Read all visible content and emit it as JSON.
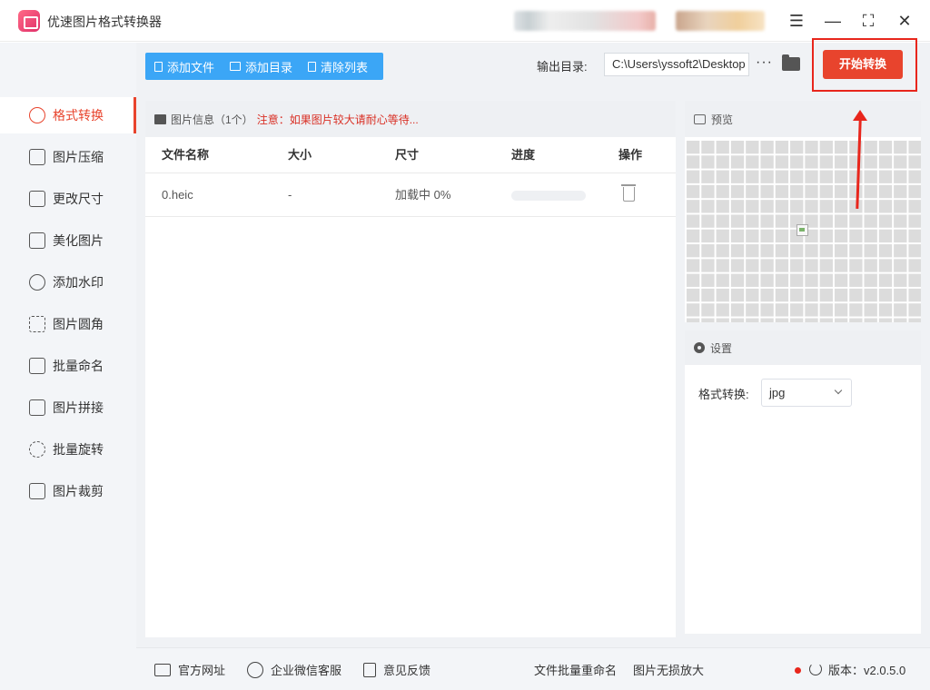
{
  "app": {
    "title": "优速图片格式转换器"
  },
  "window": {
    "menu_icon": "hamburger-menu-icon",
    "minimize": "—",
    "maximize": "⛶",
    "close": "✕"
  },
  "sidebar": {
    "items": [
      {
        "label": "格式转换",
        "icon": "format-convert-icon",
        "active": true
      },
      {
        "label": "图片压缩",
        "icon": "compress-icon"
      },
      {
        "label": "更改尺寸",
        "icon": "resize-icon"
      },
      {
        "label": "美化图片",
        "icon": "beautify-icon"
      },
      {
        "label": "添加水印",
        "icon": "watermark-icon"
      },
      {
        "label": "图片圆角",
        "icon": "rounded-corner-icon"
      },
      {
        "label": "批量命名",
        "icon": "rename-icon"
      },
      {
        "label": "图片拼接",
        "icon": "stitch-icon"
      },
      {
        "label": "批量旋转",
        "icon": "rotate-icon"
      },
      {
        "label": "图片裁剪",
        "icon": "crop-icon"
      }
    ]
  },
  "toolbar": {
    "add_file": "添加文件",
    "add_folder": "添加目录",
    "clear_list": "清除列表",
    "output_label": "输出目录:",
    "output_path": "C:\\Users\\yssoft2\\Desktop",
    "more": "···",
    "start": "开始转换",
    "accent": "#e8442d",
    "button_blue": "#3ba6f6"
  },
  "file_panel": {
    "title": "图片信息（1个）",
    "warning": "注意：如果图片较大请耐心等待...",
    "columns": [
      "文件名称",
      "大小",
      "尺寸",
      "进度",
      "操作"
    ],
    "rows": [
      {
        "name": "0.heic",
        "size": "-",
        "dimensions": "加载中 0%",
        "progress": 0
      }
    ]
  },
  "preview": {
    "title": "预览"
  },
  "settings": {
    "title": "设置",
    "format_label": "格式转换:",
    "format_value": "jpg"
  },
  "footer": {
    "website": "官方网址",
    "wechat": "企业微信客服",
    "feedback": "意见反馈",
    "batch_rename": "文件批量重命名",
    "lossless": "图片无损放大",
    "version_label": "版本：v2.0.5.0"
  }
}
